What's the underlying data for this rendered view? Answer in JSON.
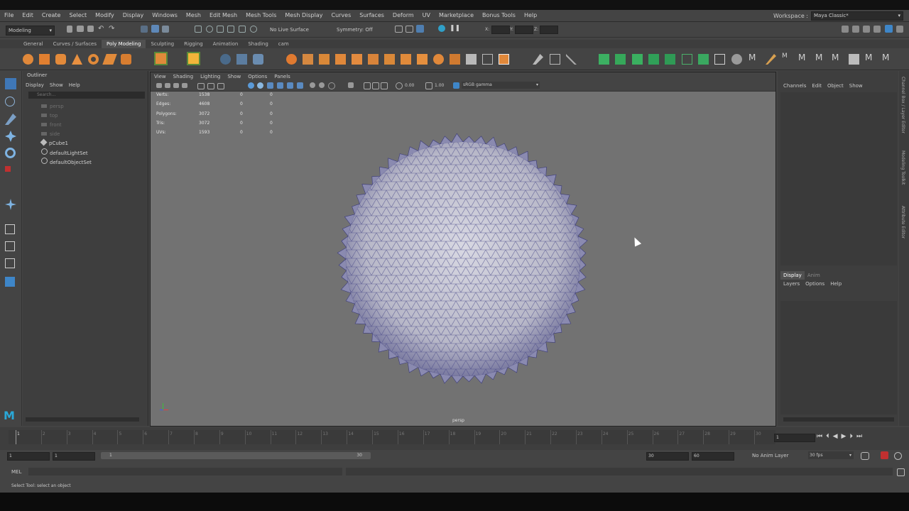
{
  "menubar": {
    "items": [
      "File",
      "Edit",
      "Create",
      "Select",
      "Modify",
      "Display",
      "Windows",
      "Mesh",
      "Edit Mesh",
      "Mesh Tools",
      "Mesh Display",
      "Curves",
      "Surfaces",
      "Deform",
      "UV",
      "Marketplace",
      "Bonus Tools",
      "Help"
    ],
    "workspace_label": "Workspace :",
    "workspace_value": "Maya Classic*"
  },
  "statusline": {
    "mode": "Modeling",
    "live_surface": "No Live Surface",
    "symmetry": "Symmetry: Off",
    "x_label": "X:",
    "y_label": "Y:",
    "z_label": "Z:"
  },
  "shelf_tabs": [
    "General",
    "Curves / Surfaces",
    "Poly Modeling",
    "Sculpting",
    "Rigging",
    "Animation",
    "Shading",
    "cam"
  ],
  "shelf_active": "Poly Modeling",
  "outliner": {
    "title": "Outliner",
    "menu": [
      "Display",
      "Show",
      "Help"
    ],
    "search_placeholder": "Search...",
    "items": [
      "persp",
      "top",
      "front",
      "side",
      "pCube1",
      "defaultLightSet",
      "defaultObjectSet"
    ]
  },
  "viewport": {
    "menu": [
      "View",
      "Shading",
      "Lighting",
      "Show",
      "Options",
      "Panels"
    ],
    "exposure": "0.00",
    "gamma": "1.00",
    "color_space": "sRGB gamma",
    "hud": [
      {
        "label": "Verts:",
        "value": "1538",
        "a": "0",
        "b": "0"
      },
      {
        "label": "Edges:",
        "value": "4608",
        "a": "0",
        "b": "0"
      },
      {
        "label": "Polygons:",
        "value": "3072",
        "a": "0",
        "b": "0"
      },
      {
        "label": "Tris:",
        "value": "3072",
        "a": "0",
        "b": "0"
      },
      {
        "label": "UVs:",
        "value": "1593",
        "a": "0",
        "b": "0"
      }
    ],
    "camera": "persp"
  },
  "channel_box": {
    "menu": [
      "Channels",
      "Edit",
      "Object",
      "Show"
    ],
    "layer_tabs": [
      "Display",
      "Anim"
    ],
    "layer_menu": [
      "Layers",
      "Options",
      "Help"
    ]
  },
  "side_tabs": [
    "Channel Box / Layer Editor",
    "Modeling Toolkit",
    "Attribute Editor"
  ],
  "timeline": {
    "ticks": [
      "1",
      "2",
      "3",
      "4",
      "5",
      "6",
      "7",
      "8",
      "9",
      "10",
      "11",
      "12",
      "13",
      "14",
      "15",
      "16",
      "17",
      "18",
      "19",
      "20",
      "21",
      "22",
      "23",
      "24",
      "25",
      "26",
      "27",
      "28",
      "29",
      "30"
    ],
    "current_frame": "1"
  },
  "range": {
    "start": "1",
    "start2": "1",
    "slider_start": "1",
    "slider_end": "30",
    "end": "30",
    "end2": "60",
    "anim_layer": "No Anim Layer",
    "fps": "30 fps"
  },
  "command": {
    "lang": "MEL"
  },
  "help_line": "Select Tool: select an object"
}
